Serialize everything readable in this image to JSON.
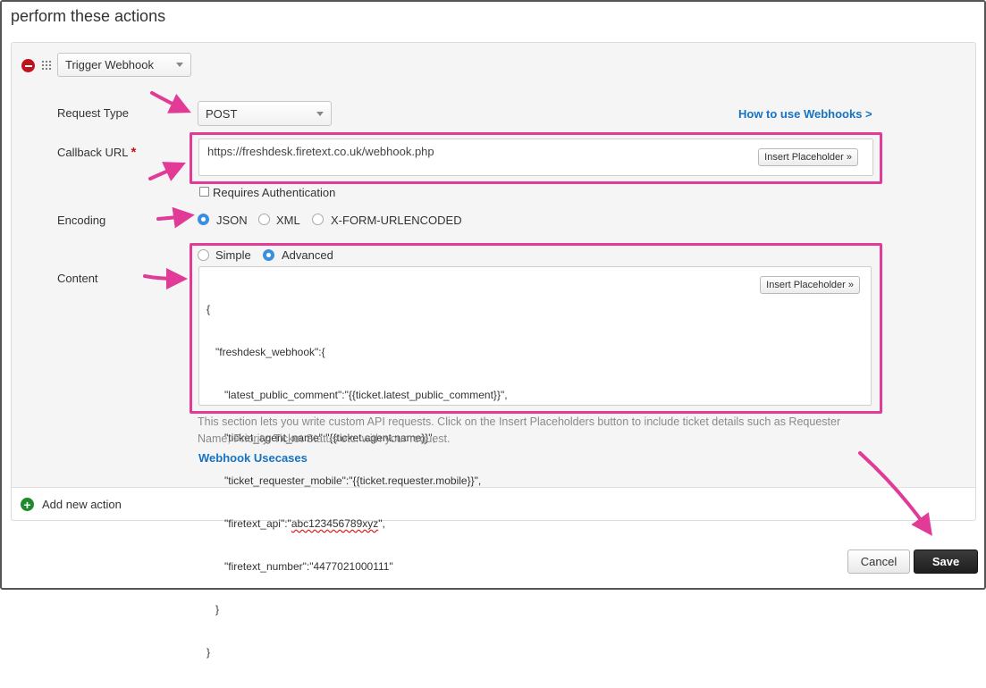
{
  "page": {
    "title": "perform these actions"
  },
  "action": {
    "type_selected": "Trigger Webhook"
  },
  "form": {
    "request_type": {
      "label": "Request Type",
      "value": "POST"
    },
    "help_link": "How to use Webhooks >",
    "callback_url": {
      "label": "Callback URL",
      "required_marker": "*",
      "value": "https://freshdesk.firetext.co.uk/webhook.php",
      "placeholder_button": "Insert Placeholder »"
    },
    "requires_auth": {
      "label": "Requires Authentication",
      "checked": false
    },
    "encoding": {
      "label": "Encoding",
      "options": [
        "JSON",
        "XML",
        "X-FORM-URLENCODED"
      ],
      "selected": "JSON"
    },
    "content": {
      "label": "Content",
      "modes": [
        "Simple",
        "Advanced"
      ],
      "selected_mode": "Advanced",
      "placeholder_button": "Insert Placeholder »",
      "lines": [
        "{",
        "   \"freshdesk_webhook\":{",
        "      \"latest_public_comment\":\"{{ticket.latest_public_comment}}\",",
        "      \"ticket_agent_name\":\"{{ticket.agent.name}}\",",
        "      \"ticket_requester_mobile\":\"{{ticket.requester.mobile}}\",",
        "      \"firetext_api\":\"",
        "      \"firetext_number\":\"4477021000111\"",
        "   }",
        "}"
      ],
      "api_key": "abc123456789xyz",
      "api_key_suffix": "\","
    },
    "help_text_line1": "This section lets you write custom API requests. Click on the Insert Placeholders button to include ticket details such as Requester",
    "help_text_line2": "Name, Priority, Ticket Status etc. with your request.",
    "usecases_link": "Webhook Usecases"
  },
  "footer": {
    "add_action": "Add new action"
  },
  "buttons": {
    "cancel": "Cancel",
    "save": "Save"
  },
  "colors": {
    "highlight": "#e23a97",
    "link": "#1673c2",
    "remove": "#c0121b",
    "add": "#1f8a2c"
  }
}
